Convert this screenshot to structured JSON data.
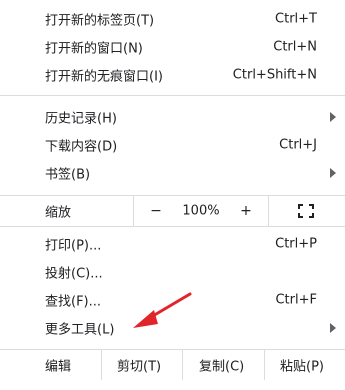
{
  "menu": {
    "group1": [
      {
        "label": "打开新的标签页(T)",
        "shortcut": "Ctrl+T"
      },
      {
        "label": "打开新的窗口(N)",
        "shortcut": "Ctrl+N"
      },
      {
        "label": "打开新的无痕窗口(I)",
        "shortcut": "Ctrl+Shift+N"
      }
    ],
    "group2": [
      {
        "label": "历史记录(H)"
      },
      {
        "label": "下载内容(D)",
        "shortcut": "Ctrl+J"
      },
      {
        "label": "书签(B)"
      }
    ],
    "zoom": {
      "label": "缩放",
      "minus": "−",
      "value": "100%",
      "plus": "+"
    },
    "group3": [
      {
        "label": "打印(P)...",
        "shortcut": "Ctrl+P"
      },
      {
        "label": "投射(C)..."
      },
      {
        "label": "查找(F)...",
        "shortcut": "Ctrl+F"
      },
      {
        "label": "更多工具(L)"
      }
    ],
    "edit": {
      "label": "编辑",
      "cut": "剪切(T)",
      "copy": "复制(C)",
      "paste": "粘贴(P)"
    }
  },
  "annotation": {
    "arrow_color": "#e0262a"
  },
  "icons": {
    "submenu": "chevron-right-icon",
    "fullscreen": "fullscreen-icon"
  }
}
